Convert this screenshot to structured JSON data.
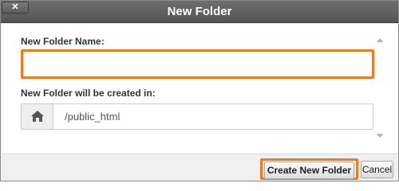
{
  "window": {
    "title": "New Folder",
    "close_glyph": "✕",
    "close_icon": "close-icon"
  },
  "form": {
    "name_label": "New Folder Name:",
    "name_value": "",
    "location_label": "New Folder will be created in:",
    "location_icon": "home-icon",
    "location_value": "/public_html"
  },
  "footer": {
    "create_label": "Create New Folder",
    "cancel_label": "Cancel"
  },
  "colors": {
    "highlight": "#f07a1e",
    "titlebar": "#5e5e5e"
  }
}
